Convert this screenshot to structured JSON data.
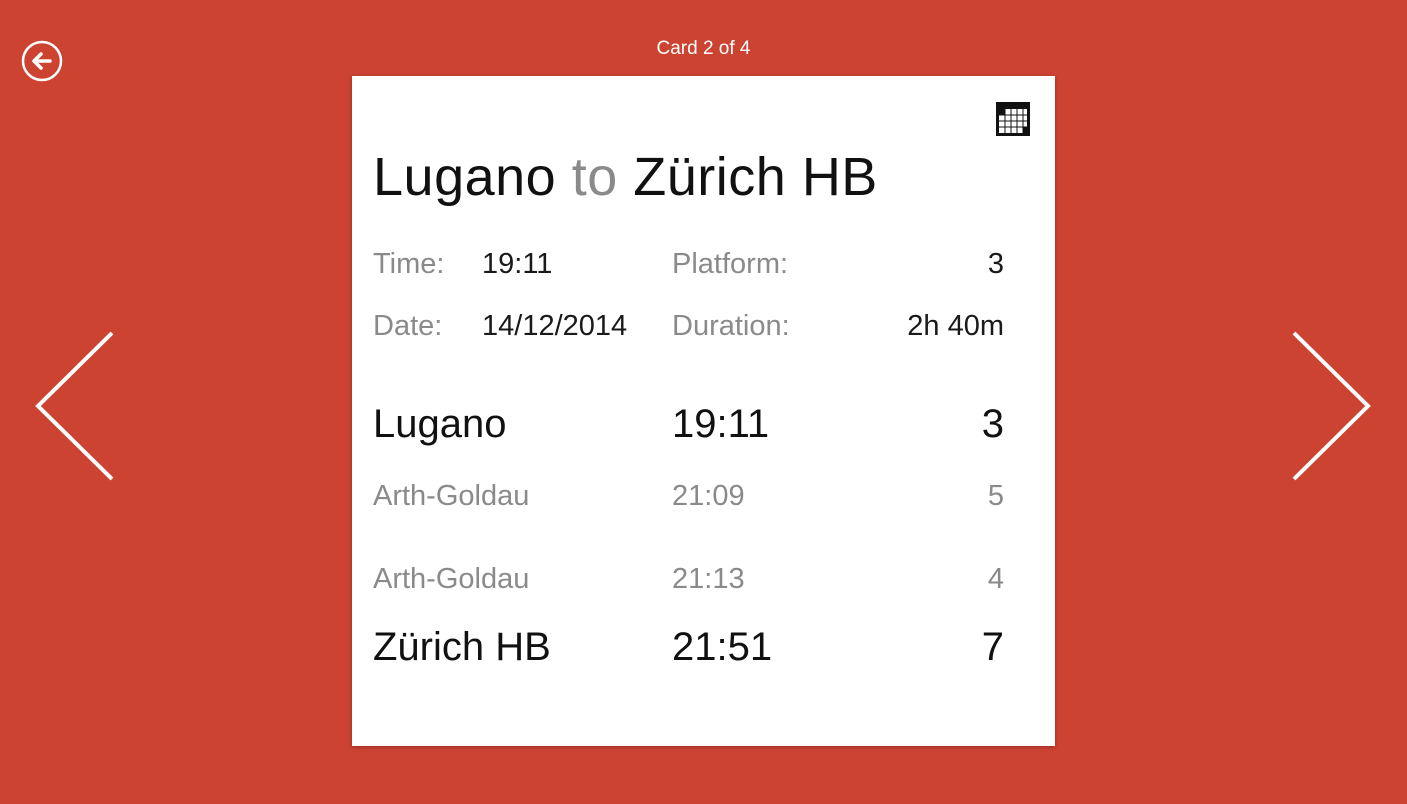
{
  "header": {
    "counter": "Card 2 of 4"
  },
  "icons": {
    "back": "back-arrow-circle-icon",
    "prev": "chevron-left-icon",
    "next": "chevron-right-icon",
    "calendar": "calendar-icon"
  },
  "colors": {
    "background": "#cc4332",
    "card": "#ffffff",
    "primary_text": "#111111",
    "muted_text": "#8a8a8a"
  },
  "card": {
    "title": {
      "from": "Lugano",
      "connector": "to",
      "to": "Zürich HB"
    },
    "info": {
      "time_label": "Time:",
      "time_value": "19:11",
      "platform_label": "Platform:",
      "platform_value": "3",
      "date_label": "Date:",
      "date_value": "14/12/2014",
      "duration_label": "Duration:",
      "duration_value": "2h 40m"
    },
    "stops": [
      {
        "name": "Lugano",
        "time": "19:11",
        "platform": "3"
      },
      {
        "name": "Arth-Goldau",
        "time": "21:09",
        "platform": "5"
      },
      {
        "name": "Arth-Goldau",
        "time": "21:13",
        "platform": "4"
      },
      {
        "name": "Zürich HB",
        "time": "21:51",
        "platform": "7"
      }
    ]
  }
}
